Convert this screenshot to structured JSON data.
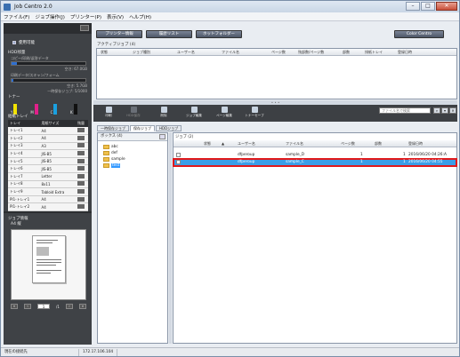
{
  "window": {
    "title": "Job Centro 2.0",
    "minimize": "–",
    "maximize": "□",
    "close": "✕"
  },
  "menu": [
    "ファイル(F)",
    "ジョブ操作(J)",
    "プリンター(P)",
    "表示(V)",
    "ヘルプ(H)"
  ],
  "left": {
    "status": "使用可能",
    "hdd_label": "HDD残量",
    "hdd_copy_label": "コピー/印刷/返答データ",
    "hdd_copy_value": "空き: 67.0GB",
    "hdd_copy_fill": 0.07,
    "hdd_scan_label": "印刷データ/スキャン/フォーム",
    "hdd_scan_value": "空き: 5.7GB",
    "hdd_scan_fill": 0.03,
    "hdd_temp_value": "一時保存ジョブ: 5/1000",
    "toner_label": "トナー",
    "toners": [
      {
        "name": "Y",
        "color": "#f2e300"
      },
      {
        "name": "M",
        "color": "#e0208a"
      },
      {
        "name": "C",
        "color": "#1aa0e0"
      },
      {
        "name": "K",
        "color": "#111111"
      }
    ],
    "tray_label": "給紙トレイ",
    "tray_headers": [
      "トレイ",
      "用紙サイズ",
      "残量"
    ],
    "trays": [
      {
        "tray": "トレイ1",
        "size": "A4"
      },
      {
        "tray": "トレイ2",
        "size": "A4"
      },
      {
        "tray": "トレイ3",
        "size": "A3"
      },
      {
        "tray": "トレイ4",
        "size": "JIS-B5"
      },
      {
        "tray": "トレイ5",
        "size": "JIS-B5"
      },
      {
        "tray": "トレイ6",
        "size": "JIS-B5"
      },
      {
        "tray": "トレイ7",
        "size": "Letter"
      },
      {
        "tray": "トレイ8",
        "size": "8x11"
      },
      {
        "tray": "トレイ9",
        "size": "Tabloid Extra"
      },
      {
        "tray": "PI1-トレイ1",
        "size": "A4"
      },
      {
        "tray": "PI1-トレイ2",
        "size": "A4"
      }
    ],
    "job_info_label": "ジョブ情報",
    "paper_size": "A4 縦",
    "page_current": "1",
    "page_total": "/1"
  },
  "top_buttons": {
    "printer_info": "プリンター情報",
    "history": "履歴リスト",
    "hot_folder": "ホットフォルダー",
    "color_centro": "Color Centro"
  },
  "active_jobs": {
    "label": "アクティブジョブ (4)",
    "headers": [
      "状態",
      "ジョブ種別",
      "ユーザー名",
      "ファイル名",
      "ページ数",
      "残部数/ページ数",
      "部数",
      "排紙トレイ",
      "登録日時"
    ]
  },
  "toolbar": {
    "print": "印刷",
    "hdd_save": "HDD保存",
    "delete": "削除",
    "job_edit": "ジョブ編集",
    "page_edit": "ページ編集",
    "toner_save": "トナーセーブ",
    "search_placeholder": "ファイル名で検索"
  },
  "tabs": [
    "一時保存ジョブ",
    "保存ジョブ",
    "HDDジョブ"
  ],
  "boxes": {
    "label": "ボックス (4)",
    "folders": [
      "abc",
      "def",
      "sample",
      "test"
    ]
  },
  "jobs": {
    "label": "ジョブ (2)",
    "headers": [
      "状態",
      "ユーザー名",
      "ファイル名",
      "ページ数",
      "部数",
      "登録日時"
    ],
    "rows": [
      {
        "user": "dfperoup",
        "file": "sample_D",
        "pages": "1",
        "copies": "1",
        "date": "2016/06/20 04:26:A"
      },
      {
        "user": "dfperoup",
        "file": "sample_C",
        "pages": "1",
        "copies": "1",
        "date": "2016/06/20 04:55"
      }
    ]
  },
  "status": {
    "connection": "現在の接続先",
    "ip": "172.17.106.104"
  }
}
